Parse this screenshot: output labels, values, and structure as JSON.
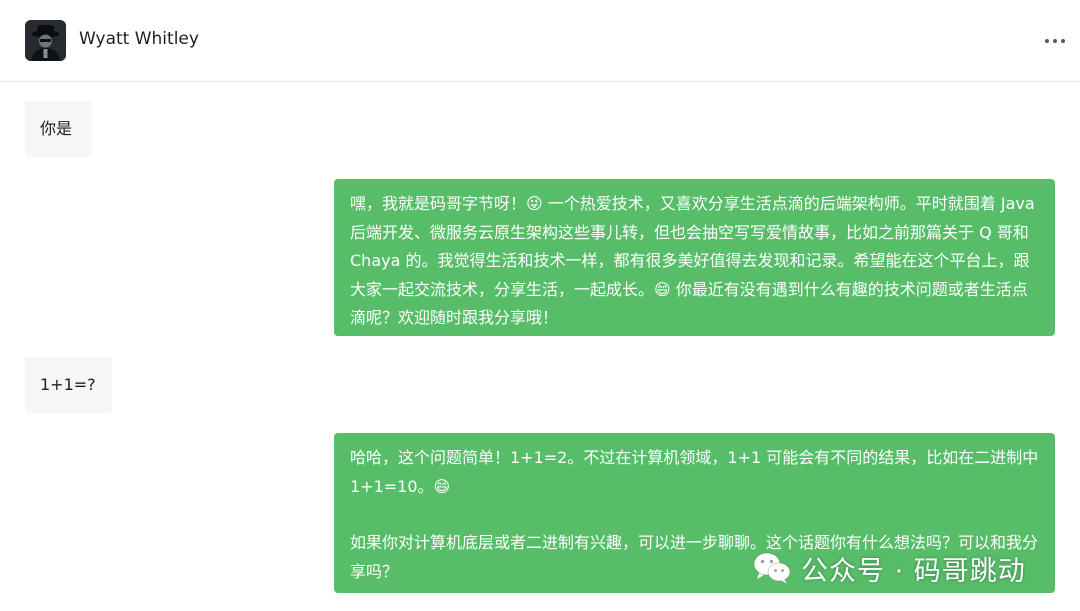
{
  "header": {
    "contact_name": "Wyatt Whitley",
    "avatar_icon": "avatar-icon",
    "more_icon": "more-dots-icon"
  },
  "messages": [
    {
      "direction": "incoming",
      "lines": [
        "你是"
      ]
    },
    {
      "direction": "outgoing",
      "paragraphs": [
        "嘿，我就是码哥字节呀！😜 一个热爱技术，又喜欢分享生活点滴的后端架构师。平时就围着 Java 后端开发、微服务云原生架构这些事儿转，但也会抽空写写爱情故事，比如之前那篇关于 Q 哥和 Chaya 的。我觉得生活和技术一样，都有很多美好值得去发现和记录。希望能在这个平台上，跟大家一起交流技术，分享生活，一起成长。😄 你最近有没有遇到什么有趣的技术问题或者生活点滴呢？欢迎随时跟我分享哦！"
      ]
    },
    {
      "direction": "incoming",
      "lines": [
        "1+1=?"
      ]
    },
    {
      "direction": "outgoing",
      "paragraphs": [
        "哈哈，这个问题简单！1+1=2。不过在计算机领域，1+1 可能会有不同的结果，比如在二进制中 1+1=10。😄",
        "如果你对计算机底层或者二进制有兴趣，可以进一步聊聊。这个话题你有什么想法吗？可以和我分享吗？"
      ]
    }
  ],
  "watermark": {
    "text": "公众号 · 码哥跳动",
    "icon": "wechat-logo-icon"
  },
  "colors": {
    "outgoing_bubble": "#57bd69",
    "incoming_bubble": "#f5f6f7",
    "divider": "#e6e6e6"
  }
}
